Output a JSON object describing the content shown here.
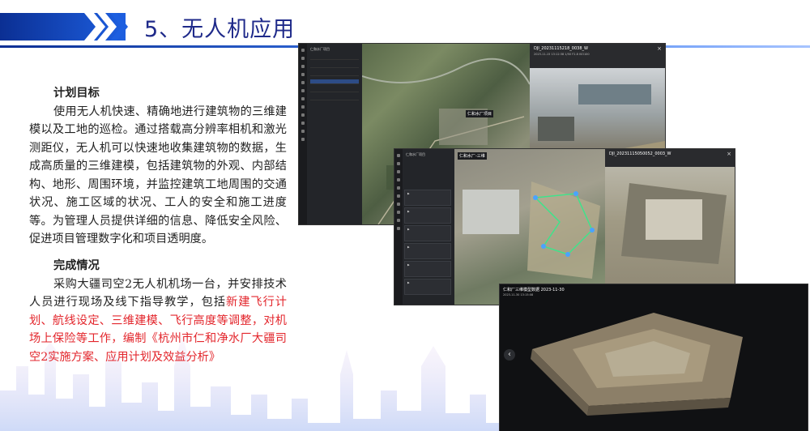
{
  "header": {
    "title": "5、无人机应用"
  },
  "plan": {
    "heading": "计划目标",
    "body": "使用无人机快速、精确地进行建筑物的三维建模以及工地的巡检。通过搭载高分辨率相机和激光测距仪，无人机可以快速地收集建筑物的数据，生成高质量的三维建模，包括建筑物的外观、内部结构、地形、周围环境，并监控建筑工地周围的交通状况、施工区域的状况、工人的安全和施工进度等。为管理人员提供详细的信息、降低安全风险、促进项目管理数字化和项目透明度。"
  },
  "done": {
    "heading": "完成情况",
    "body_start": "采购大疆司空2无人机机场一台，并安排技术人员进行现场及线下指导教学，包括",
    "highlight": "新建飞行计划、航线设定、三维建模、飞行高度等调整，对机场上保险等工作，编制《杭州市仁和净水厂大疆司空2实施方案、应用计划及效益分析》"
  },
  "screenshots": {
    "s1": {
      "panel_title": "仁和水厂项目",
      "viewer_title": "DJI_20231115218_0038_W",
      "viewer_meta": "2023-11-15 13:12:38  1/50  F2.8  ISO100",
      "map_label": "仁和水厂项目"
    },
    "s2": {
      "panel_title": "仁和水厂项目",
      "map_label": "仁和水厂-三维",
      "viewer_title": "DJI_20231115050052_0003_W"
    },
    "s3": {
      "model_title": "仁和厂三维模型数据 2023-11-30",
      "model_meta": "2023-11-30 13:15:08"
    }
  },
  "colors": {
    "title": "#1f2a8a",
    "accent": "#1d5fe0",
    "highlight": "#e3262c"
  }
}
